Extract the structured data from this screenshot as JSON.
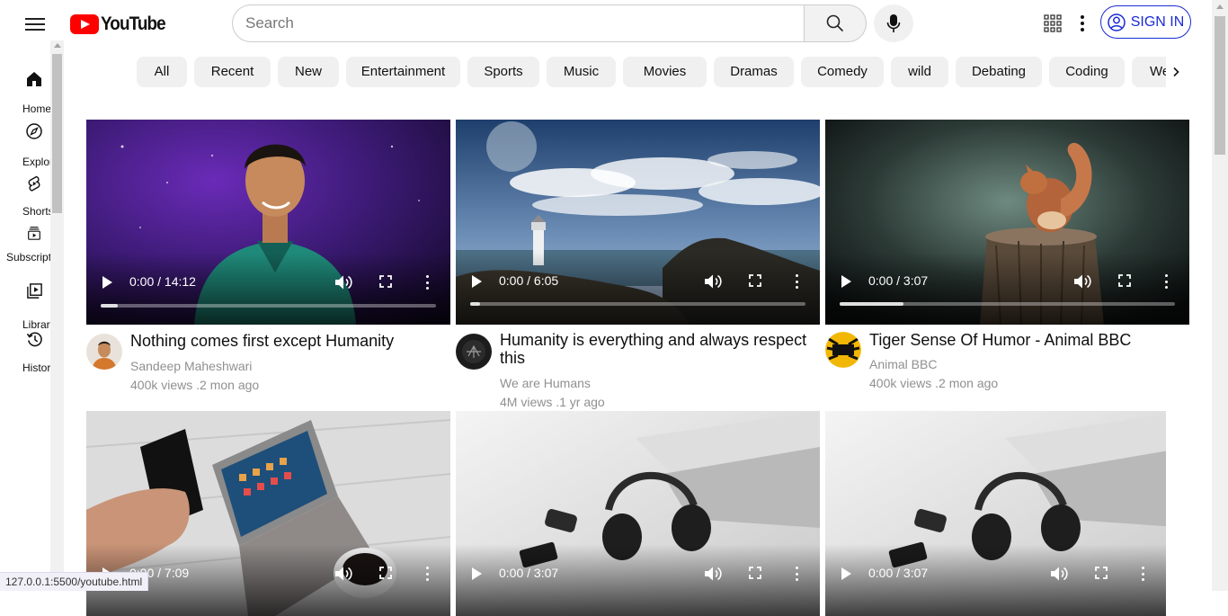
{
  "header": {
    "logo_text": "YouTube",
    "search_placeholder": "Search",
    "signin_label": "SIGN IN"
  },
  "sidebar": {
    "items": [
      {
        "label": "Home",
        "icon": "home-icon"
      },
      {
        "label": "Explore",
        "icon": "compass-icon"
      },
      {
        "label": "Shorts",
        "icon": "shorts-icon"
      },
      {
        "label": "Subscriptions",
        "icon": "subscriptions-icon"
      },
      {
        "label": "Library",
        "icon": "library-icon"
      },
      {
        "label": "History",
        "icon": "history-icon"
      }
    ]
  },
  "chips": [
    "All",
    "Recent",
    "New",
    "Entertainment",
    "Sports",
    "Music",
    "Movies",
    "Dramas",
    "Comedy",
    "wild",
    "Debating",
    "Coding",
    "Web"
  ],
  "videos": [
    {
      "time": "0:00 / 14:12",
      "progress": 0.05,
      "title": "Nothing comes first except Humanity",
      "channel": "Sandeep Maheshwari",
      "stats": "400k views .2 mon ago"
    },
    {
      "time": "0:00 / 6:05",
      "progress": 0.03,
      "title": "Humanity is everything and always respect this",
      "channel": "We are Humans",
      "stats": "4M views .1 yr ago"
    },
    {
      "time": "0:00 / 3:07",
      "progress": 0.19,
      "title": "Tiger Sense Of Humor - Animal BBC",
      "channel": "Animal BBC",
      "stats": "400k views .2 mon ago"
    },
    {
      "time": "0:00 / 7:09",
      "progress": 0
    },
    {
      "time": "0:00 / 3:07",
      "progress": 0
    },
    {
      "time": "0:00 / 3:07",
      "progress": 0
    }
  ],
  "status_bar": {
    "url": "127.0.0.1:5500/youtube.html"
  },
  "colors": {
    "brand_red": "#ff0000",
    "signin_blue": "#1a2bd4"
  }
}
